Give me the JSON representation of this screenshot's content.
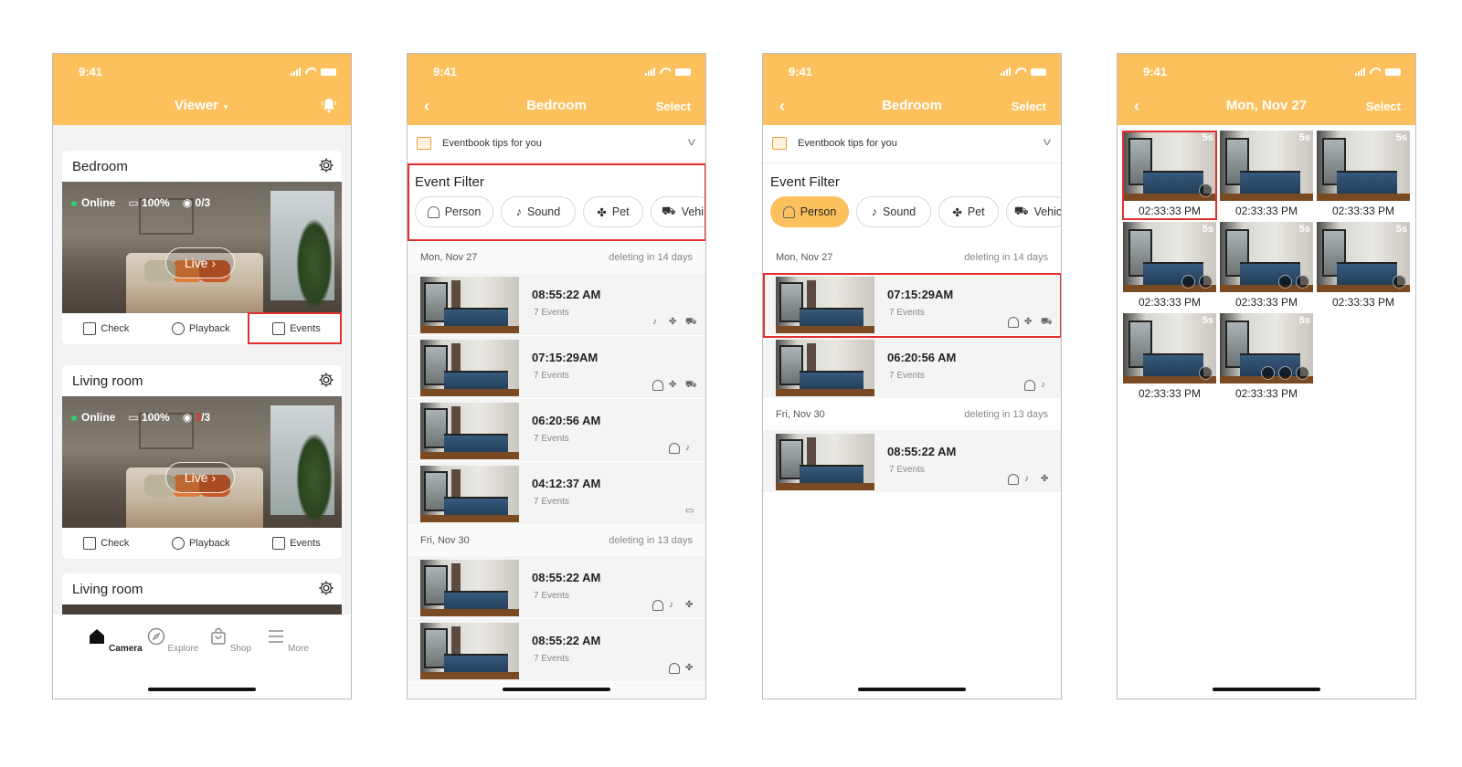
{
  "status": {
    "time": "9:41"
  },
  "screen1": {
    "title": "Viewer",
    "cards": [
      {
        "name": "Bedroom",
        "online": "Online",
        "battery": "100%",
        "viewers": "0/3",
        "live": "Live"
      },
      {
        "name": "Living room",
        "online": "Online",
        "battery": "100%",
        "viewers_highlight": "3",
        "viewers_rest": "/3",
        "live": "Live"
      },
      {
        "name": "Living room"
      }
    ],
    "actions": {
      "check": "Check",
      "playback": "Playback",
      "events": "Events"
    },
    "tabs": {
      "camera": "Camera",
      "explore": "Explore",
      "shop": "Shop",
      "more": "More"
    }
  },
  "screen2": {
    "title": "Bedroom",
    "select": "Select",
    "tips": "Eventbook tips for you",
    "filter_title": "Event Filter",
    "chips": {
      "person": "Person",
      "sound": "Sound",
      "pet": "Pet",
      "vehicle": "Vehi"
    },
    "groups": [
      {
        "date": "Mon, Nov 27",
        "deleting": "deleting in 14 days",
        "events": [
          {
            "time": "08:55:22 AM",
            "count": "7 Events"
          },
          {
            "time": "07:15:29AM",
            "count": "7 Events"
          },
          {
            "time": "06:20:56 AM",
            "count": "7 Events"
          },
          {
            "time": "04:12:37 AM",
            "count": "7 Events"
          }
        ]
      },
      {
        "date": "Fri, Nov 30",
        "deleting": "deleting in 13 days",
        "events": [
          {
            "time": "08:55:22 AM",
            "count": "7 Events"
          },
          {
            "time": "08:55:22 AM",
            "count": "7 Events"
          }
        ]
      }
    ]
  },
  "screen3": {
    "title": "Bedroom",
    "select": "Select",
    "tips": "Eventbook tips for you",
    "filter_title": "Event Filter",
    "chips": {
      "person": "Person",
      "sound": "Sound",
      "pet": "Pet",
      "vehicle": "Vehic"
    },
    "groups": [
      {
        "date": "Mon, Nov 27",
        "deleting": "deleting in 14 days",
        "events": [
          {
            "time": "07:15:29AM",
            "count": "7 Events"
          },
          {
            "time": "06:20:56 AM",
            "count": "7 Events"
          }
        ]
      },
      {
        "date": "Fri, Nov 30",
        "deleting": "deleting in 13 days",
        "events": [
          {
            "time": "08:55:22 AM",
            "count": "7 Events"
          }
        ]
      }
    ]
  },
  "screen4": {
    "title": "Mon, Nov 27",
    "select": "Select",
    "duration": "5s",
    "clips": [
      "02:33:33 PM",
      "02:33:33 PM",
      "02:33:33 PM",
      "02:33:33 PM",
      "02:33:33 PM",
      "02:33:33 PM",
      "02:33:33 PM",
      "02:33:33 PM"
    ]
  },
  "colors": {
    "accent": "#fcc05c",
    "highlight": "#e0312f",
    "online": "#2ecc71",
    "viewer_alert": "#e0312f"
  }
}
